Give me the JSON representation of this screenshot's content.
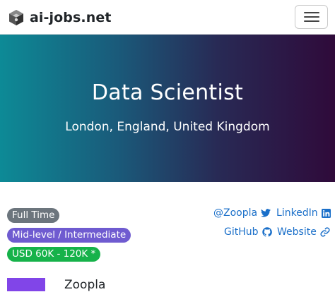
{
  "navbar": {
    "brand_name": "ai-jobs.net",
    "logo_icon": "ai-jobs-logo-icon",
    "menu_icon": "hamburger-menu-icon"
  },
  "hero": {
    "title": "Data Scientist",
    "location": "London, England, United Kingdom",
    "gradient_colors": [
      "#0d8a96",
      "#2f0a3a"
    ]
  },
  "badges": {
    "employment_type": "Full Time",
    "level": "Mid-level / Intermediate",
    "salary": "USD 60K - 120K *"
  },
  "links": {
    "twitter": {
      "label": "@Zoopla",
      "icon": "twitter-icon"
    },
    "linkedin": {
      "label": "LinkedIn",
      "icon": "linkedin-icon"
    },
    "github": {
      "label": "GitHub",
      "icon": "github-icon"
    },
    "website": {
      "label": "Website",
      "icon": "link-icon"
    }
  },
  "company": {
    "name": "Zoopla",
    "logo_color": "#8145e8"
  },
  "colors": {
    "link": "#1a6fc9",
    "badge_type": "#6c757d",
    "badge_level": "#6f5bd0",
    "badge_salary": "#16b24a"
  }
}
